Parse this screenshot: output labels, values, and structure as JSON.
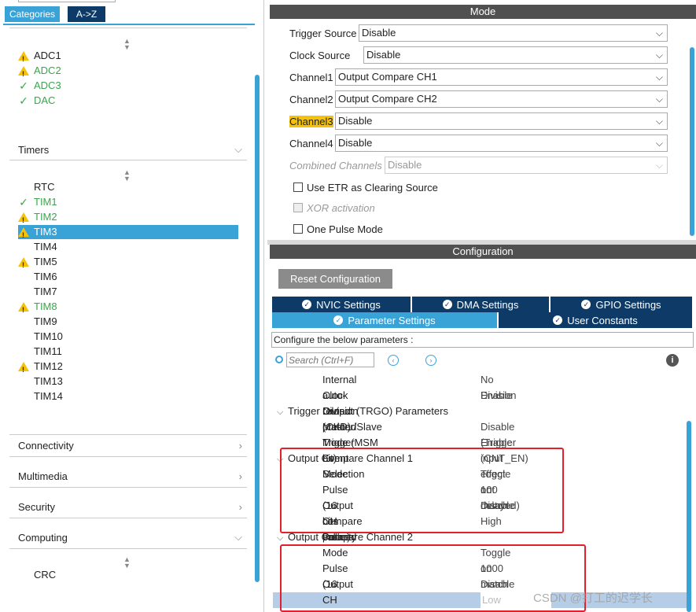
{
  "left": {
    "tabs": {
      "categories": "Categories",
      "atoz": "A->Z"
    },
    "analog_items": [
      {
        "label": "ADC1",
        "icon": "warning",
        "color": "normal"
      },
      {
        "label": "ADC2",
        "icon": "warning",
        "color": "green"
      },
      {
        "label": "ADC3",
        "icon": "check",
        "color": "green"
      },
      {
        "label": "DAC",
        "icon": "check",
        "color": "green"
      }
    ],
    "timers": {
      "label": "Timers"
    },
    "timer_items": [
      {
        "label": "RTC",
        "icon": "none",
        "color": "normal"
      },
      {
        "label": "TIM1",
        "icon": "check",
        "color": "green"
      },
      {
        "label": "TIM2",
        "icon": "warning",
        "color": "green"
      },
      {
        "label": "TIM3",
        "icon": "warning",
        "color": "selected"
      },
      {
        "label": "TIM4",
        "icon": "none",
        "color": "normal"
      },
      {
        "label": "TIM5",
        "icon": "warning",
        "color": "normal"
      },
      {
        "label": "TIM6",
        "icon": "none",
        "color": "normal"
      },
      {
        "label": "TIM7",
        "icon": "none",
        "color": "normal"
      },
      {
        "label": "TIM8",
        "icon": "warning",
        "color": "green"
      },
      {
        "label": "TIM9",
        "icon": "none",
        "color": "normal"
      },
      {
        "label": "TIM10",
        "icon": "none",
        "color": "normal"
      },
      {
        "label": "TIM11",
        "icon": "none",
        "color": "normal"
      },
      {
        "label": "TIM12",
        "icon": "warning",
        "color": "normal"
      },
      {
        "label": "TIM13",
        "icon": "none",
        "color": "normal"
      },
      {
        "label": "TIM14",
        "icon": "none",
        "color": "normal"
      }
    ],
    "categories": {
      "connectivity": "Connectivity",
      "multimedia": "Multimedia",
      "security": "Security",
      "computing": "Computing"
    },
    "computing_items": [
      "CRC"
    ]
  },
  "mode": {
    "header": "Mode",
    "trigger_source": {
      "label": "Trigger Source",
      "value": "Disable"
    },
    "clock_source": {
      "label": "Clock Source",
      "value": "Disable"
    },
    "channel1": {
      "label": "Channel1",
      "value": "Output Compare CH1"
    },
    "channel2": {
      "label": "Channel2",
      "value": "Output Compare CH2"
    },
    "channel3": {
      "label": "Channel3",
      "value": "Disable"
    },
    "channel4": {
      "label": "Channel4",
      "value": "Disable"
    },
    "combined": {
      "label": "Combined Channels",
      "value": "Disable"
    },
    "etr": "Use ETR as Clearing Source",
    "xor": "XOR activation",
    "one_pulse": "One Pulse Mode"
  },
  "config": {
    "header": "Configuration",
    "reset": "Reset Configuration",
    "tabs": {
      "nvic": "NVIC Settings",
      "dma": "DMA Settings",
      "gpio": "GPIO Settings",
      "param": "Parameter Settings",
      "user": "User Constants"
    },
    "configure_text": "Configure the below parameters :",
    "search_placeholder": "Search (Ctrl+F)",
    "rows": {
      "ckd_k": "Internal Clock Division (CKD)",
      "ckd_v": "No Division",
      "arp_k": "auto-reload preload",
      "arp_v": "Enable",
      "trgo": "Trigger Output (TRGO) Parameters",
      "msm_k": "Master/Slave Mode (MSM bit)",
      "msm_v": "Disable (Trigger input effect not delayed)",
      "tes_k": "Trigger Event Selection",
      "tes_v": "Enable (CNT_EN)",
      "oc1": "Output Compare Channel 1",
      "oc1_mode_k": "Mode",
      "oc1_mode_v": "Toggle on match",
      "oc1_pulse_k": "Pulse (16 bits value)",
      "oc1_pulse_v": "100",
      "oc1_pre_k": "Output compare preload",
      "oc1_pre_v": "Disable",
      "oc1_pol_k": "CH Polarity",
      "oc1_pol_v": "High",
      "oc2": "Output Compare Channel 2",
      "oc2_mode_k": "Mode",
      "oc2_mode_v": "Toggle on match",
      "oc2_pulse_k": "Pulse (16 bits value)",
      "oc2_pulse_v": "1000",
      "oc2_pre_k": "Output compare preload",
      "oc2_pre_v": "Disable",
      "oc2_pol_k": "CH Polarity",
      "oc2_pol_v": "Low"
    }
  },
  "watermark": "CSDN @打工的迟学长",
  "colors": {
    "accent": "#39a3d8",
    "header": "#505050",
    "tab_dark": "#0d3a66",
    "highlight": "#f4c20d",
    "green": "#3aa64b",
    "red": "#e0202a"
  }
}
